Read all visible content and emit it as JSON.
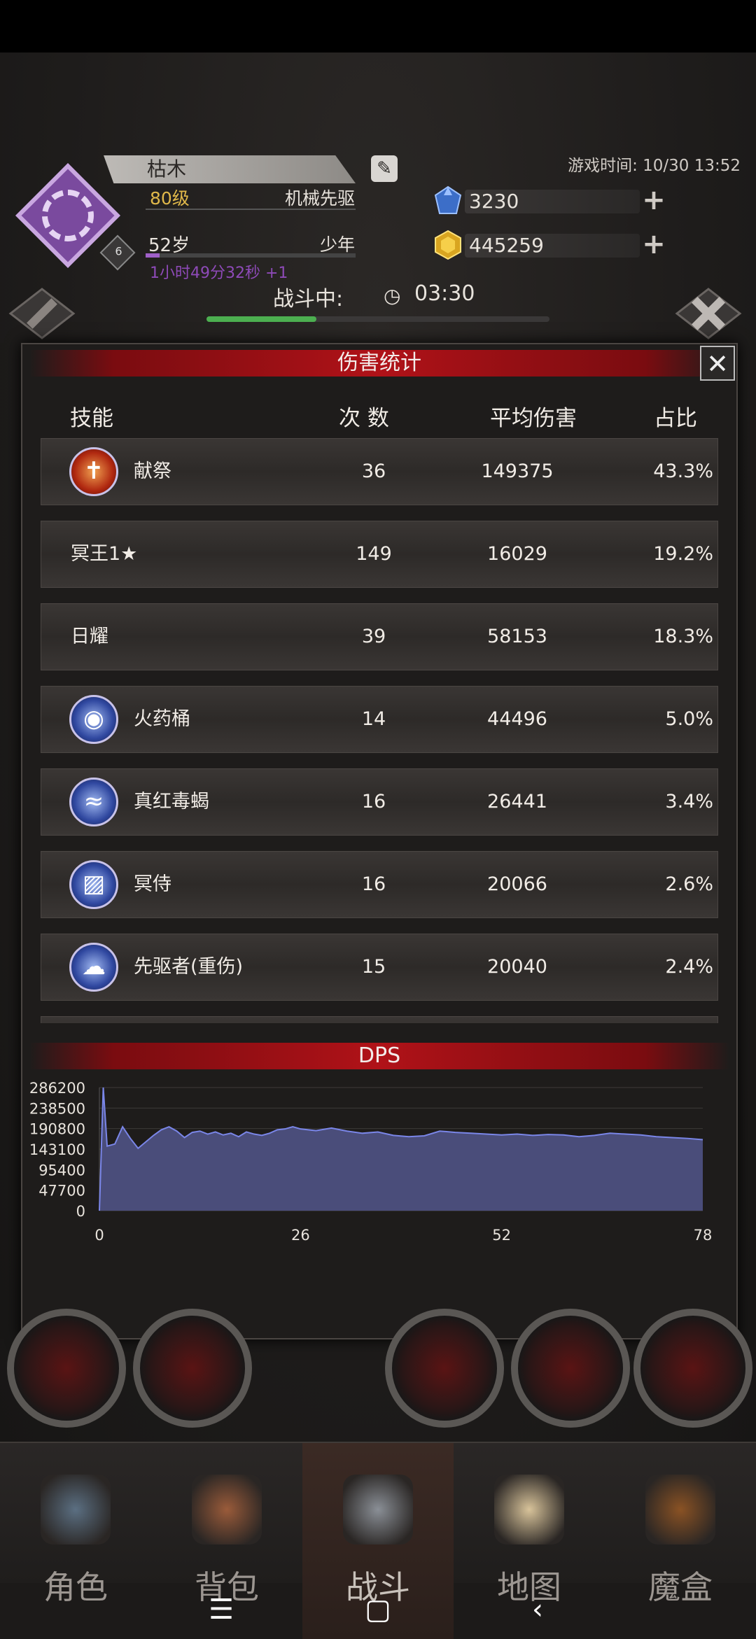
{
  "header": {
    "player_name": "枯木",
    "level": "80级",
    "class_name": "机械先驱",
    "emblem_level": "6",
    "age": "52岁",
    "age_stage": "少年",
    "online_time": "1小时49分32秒 +1",
    "game_time": "游戏时间: 10/30 13:52",
    "blue_gems": "3230",
    "gold_gems": "445259",
    "battle_label": "战斗中:",
    "battle_timer": "03:30",
    "battle_progress_pct": 32
  },
  "modal": {
    "title": "伤害统计",
    "close_label": "✕",
    "columns": {
      "skill": "技能",
      "count": "次 数",
      "avg": "平均伤害",
      "pct": "占比"
    },
    "rows": [
      {
        "name": "献祭",
        "count": "36",
        "avg": "149375",
        "pct": "43.3%",
        "icon": "sacrifice-icon",
        "glyph": "✝",
        "style": "red"
      },
      {
        "name": "冥王1★",
        "count": "149",
        "avg": "16029",
        "pct": "19.2%",
        "icon": "",
        "glyph": "",
        "style": "none"
      },
      {
        "name": "日耀",
        "count": "39",
        "avg": "58153",
        "pct": "18.3%",
        "icon": "",
        "glyph": "",
        "style": "none"
      },
      {
        "name": "火药桶",
        "count": "14",
        "avg": "44496",
        "pct": "5.0%",
        "icon": "powder-keg-icon",
        "glyph": "◉",
        "style": "blue"
      },
      {
        "name": "真红毒蝎",
        "count": "16",
        "avg": "26441",
        "pct": "3.4%",
        "icon": "scorpion-icon",
        "glyph": "≈",
        "style": "blue"
      },
      {
        "name": "冥侍",
        "count": "16",
        "avg": "20066",
        "pct": "2.6%",
        "icon": "servant-icon",
        "glyph": "▨",
        "style": "blue"
      },
      {
        "name": "先驱者(重伤)",
        "count": "15",
        "avg": "20040",
        "pct": "2.4%",
        "icon": "explosion-icon",
        "glyph": "☁",
        "style": "blue"
      }
    ],
    "dps_title": "DPS"
  },
  "chart_data": {
    "type": "area",
    "title": "DPS",
    "x_ticks": [
      "0",
      "26",
      "52",
      "78"
    ],
    "y_ticks": [
      "286200",
      "238500",
      "190800",
      "143100",
      "95400",
      "47700",
      "0"
    ],
    "xlim": [
      0,
      78
    ],
    "ylim": [
      0,
      286200
    ],
    "grid": true,
    "color": "#4a4d7a",
    "line_color": "#7a86e8",
    "x": [
      0,
      0.5,
      1,
      2,
      3,
      4,
      5,
      6,
      7,
      8,
      9,
      10,
      11,
      12,
      13,
      14,
      15,
      16,
      17,
      18,
      19,
      20,
      21,
      22,
      23,
      24,
      25,
      26,
      28,
      30,
      32,
      34,
      36,
      38,
      40,
      42,
      44,
      46,
      48,
      50,
      52,
      54,
      56,
      58,
      60,
      62,
      64,
      66,
      68,
      70,
      72,
      74,
      76,
      78
    ],
    "y": [
      0,
      286200,
      150000,
      155000,
      195000,
      168000,
      145000,
      160000,
      175000,
      188000,
      195000,
      185000,
      170000,
      182000,
      185000,
      178000,
      183000,
      176000,
      180000,
      172000,
      183000,
      178000,
      175000,
      180000,
      188000,
      190000,
      195000,
      190000,
      186000,
      192000,
      185000,
      180000,
      183000,
      175000,
      172000,
      174000,
      185000,
      182000,
      180000,
      178000,
      176000,
      178000,
      175000,
      177000,
      176000,
      172000,
      175000,
      180000,
      178000,
      176000,
      172000,
      170000,
      168000,
      165000
    ]
  },
  "nav": {
    "items": [
      {
        "label": "角色",
        "icon": "helmet-icon",
        "color": "#5b6f82"
      },
      {
        "label": "背包",
        "icon": "backpack-icon",
        "color": "#9a5b3a"
      },
      {
        "label": "战斗",
        "icon": "sword-shield-icon",
        "color": "#8a8f96"
      },
      {
        "label": "地图",
        "icon": "scroll-icon",
        "color": "#d8c39a"
      },
      {
        "label": "魔盒",
        "icon": "magic-box-icon",
        "color": "#8a5224"
      }
    ],
    "active_index": 2
  },
  "system_nav": {
    "menu": "☰",
    "home": "▢",
    "back": "‹"
  }
}
